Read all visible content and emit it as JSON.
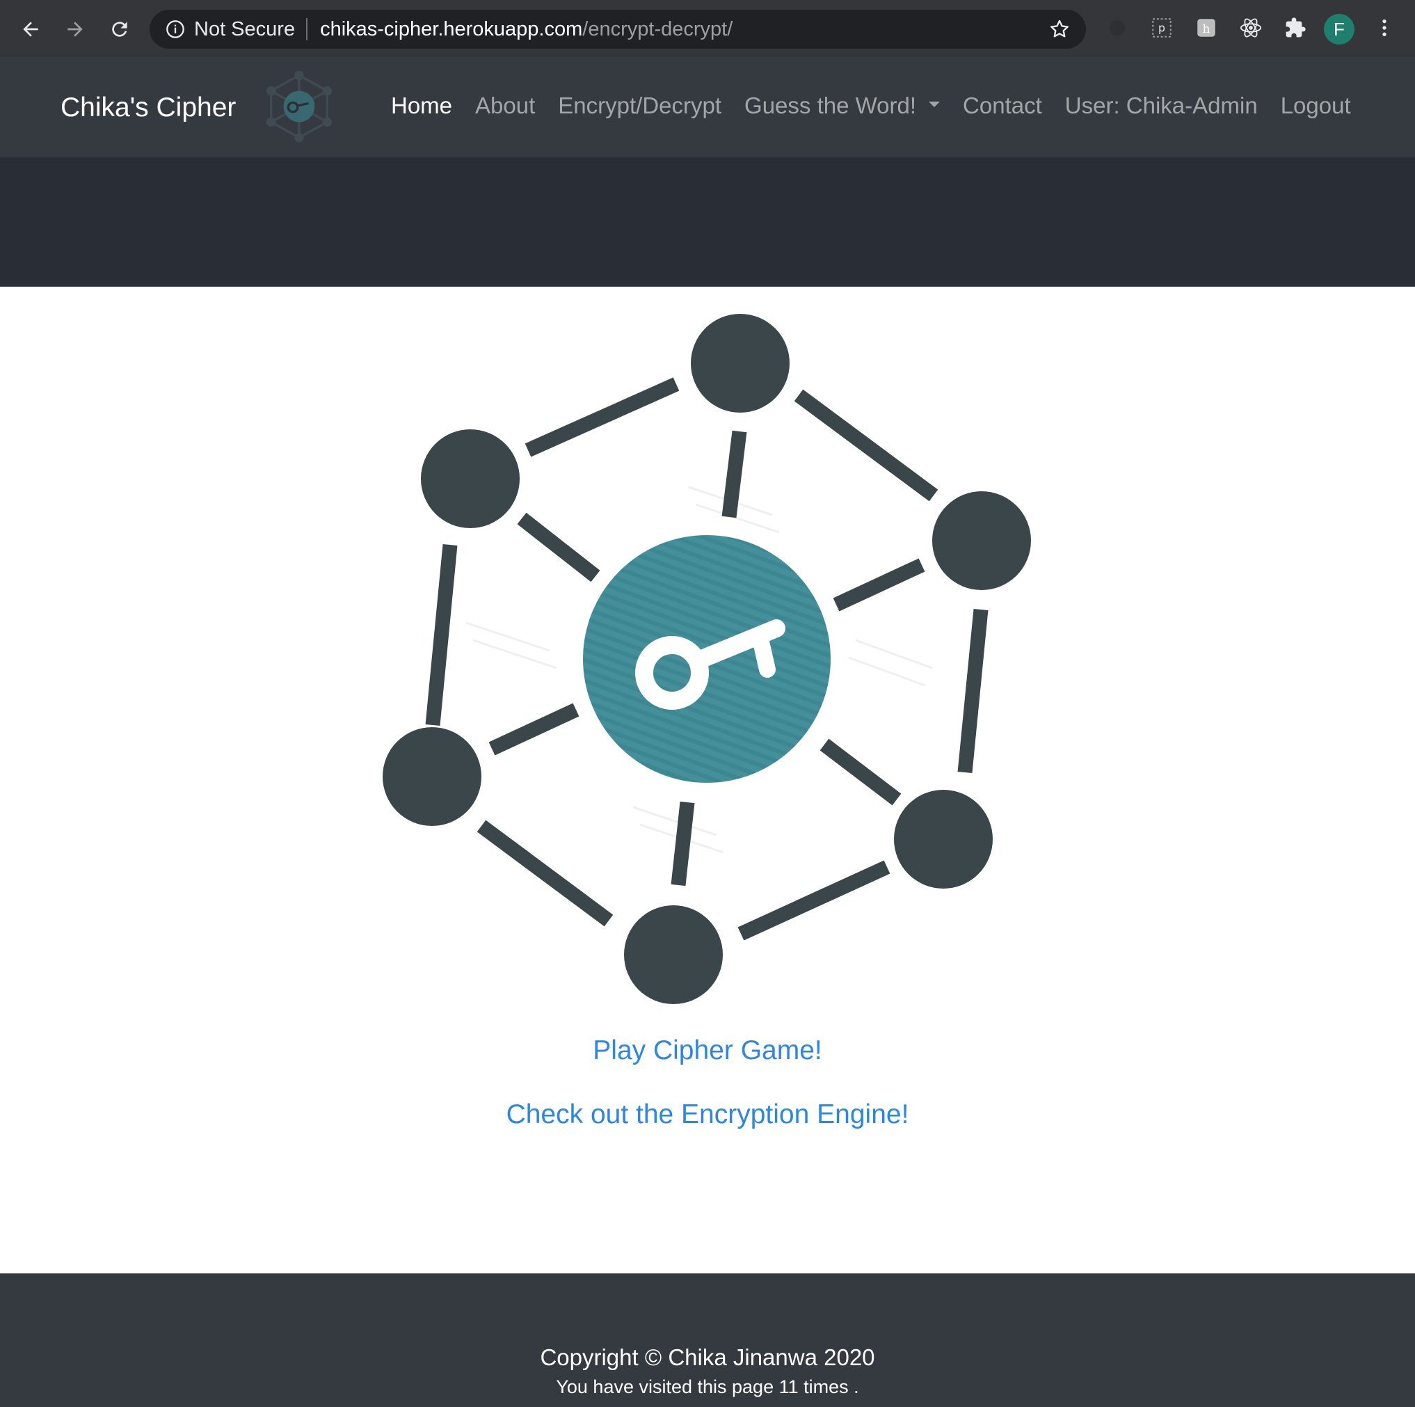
{
  "browser": {
    "security_label": "Not Secure",
    "url_host": "chikas-cipher.herokuapp.com",
    "url_path": "/encrypt-decrypt/",
    "profile_initial": "F",
    "icons": [
      "back-arrow-icon",
      "forward-arrow-icon",
      "reload-icon",
      "info-icon",
      "star-icon",
      "extension-icon",
      "menu-dots-icon"
    ]
  },
  "navbar": {
    "brand": "Chika's Cipher",
    "links": [
      {
        "label": "Home",
        "active": true
      },
      {
        "label": "About"
      },
      {
        "label": "Encrypt/Decrypt"
      },
      {
        "label": "Guess the Word!",
        "dropdown": true
      },
      {
        "label": "Contact"
      },
      {
        "label": "User: Chika-Admin"
      },
      {
        "label": "Logout"
      }
    ]
  },
  "main": {
    "play_link": "Play Cipher Game!",
    "engine_link": "Check out the Encryption Engine!"
  },
  "footer": {
    "copyright": "Copyright © Chika Jinanwa 2020",
    "visits": "You have visited this page 11 times ."
  },
  "colors": {
    "nav_bg": "#343a40",
    "jumbo_bg": "#292d35",
    "link": "#2f86e0",
    "logo_teal": "#3f8f9a",
    "logo_dark": "#3b464b"
  }
}
